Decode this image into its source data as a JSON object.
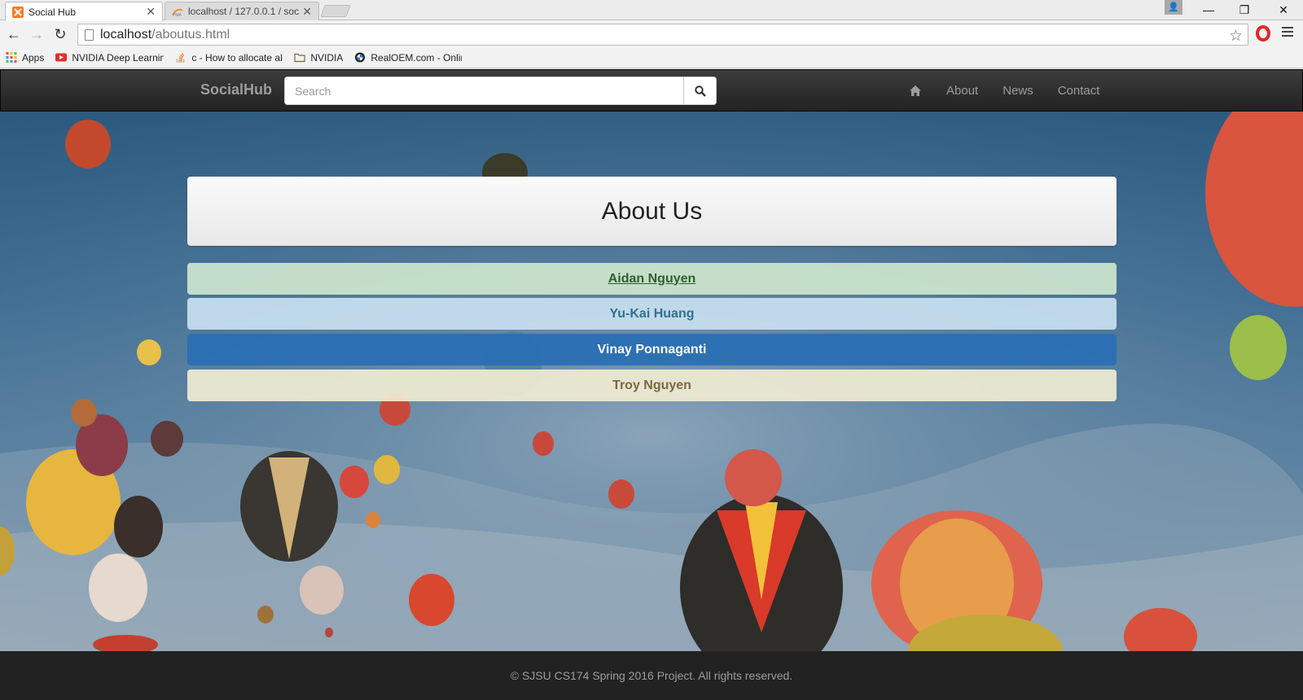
{
  "browser": {
    "tabs": [
      {
        "title": "Social Hub",
        "active": true
      },
      {
        "title": "localhost / 127.0.0.1 / soc",
        "active": false
      }
    ],
    "url_host": "localhost",
    "url_path": "/aboutus.html",
    "bookmarks": [
      {
        "label": "Apps",
        "icon": "apps-grid-icon"
      },
      {
        "label": "NVIDIA Deep Learning",
        "icon": "youtube-icon"
      },
      {
        "label": "c - How to allocate al",
        "icon": "stackoverflow-icon"
      },
      {
        "label": "NVIDIA",
        "icon": "folder-icon"
      },
      {
        "label": "RealOEM.com - Onlin",
        "icon": "bmw-icon"
      }
    ]
  },
  "navbar": {
    "brand": "SocialHub",
    "search_placeholder": "Search",
    "links": [
      {
        "label": "About"
      },
      {
        "label": "News"
      },
      {
        "label": "Contact"
      }
    ]
  },
  "about": {
    "title": "About Us",
    "members": [
      {
        "name": "Aidan Nguyen"
      },
      {
        "name": "Yu-Kai Huang"
      },
      {
        "name": "Vinay Ponnaganti"
      },
      {
        "name": "Troy Nguyen"
      }
    ]
  },
  "footer": {
    "text": "© SJSU CS174 Spring 2016 Project. All rights reserved."
  },
  "colors": {
    "navbar_bg": "#222222",
    "member_success": "#dff0d8",
    "member_info": "#d9edf7",
    "member_primary": "#337ab7",
    "member_warning": "#fcf8e3"
  }
}
